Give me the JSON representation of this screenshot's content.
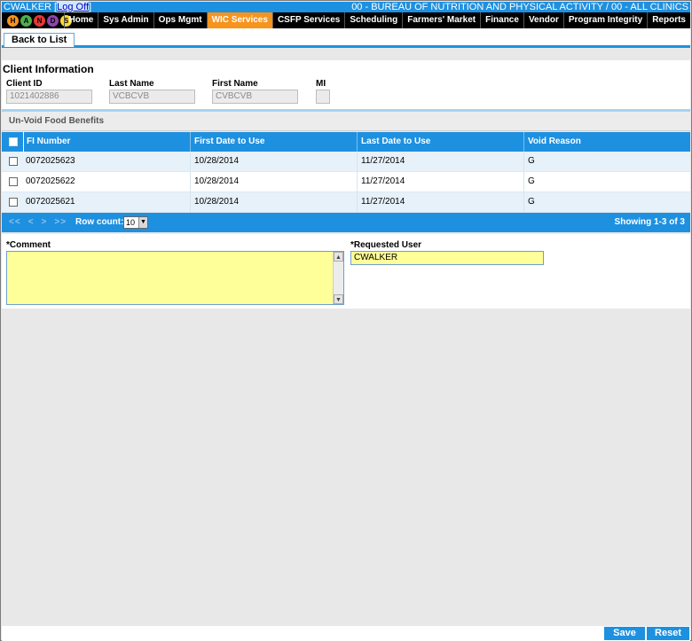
{
  "topbar": {
    "user": "CWALKER",
    "logoff": "Log Off",
    "organization": "00 - BUREAU OF NUTRITION AND PHYSICAL ACTIVITY / 00 - ALL CLINICS"
  },
  "logo": {
    "letters": [
      "H",
      "A",
      "N",
      "D",
      "S"
    ],
    "colors": [
      "#f7941d",
      "#4caf50",
      "#e53935",
      "#8e44ad",
      "#fdd835"
    ]
  },
  "nav": [
    {
      "label": "Home"
    },
    {
      "label": "Sys Admin"
    },
    {
      "label": "Ops Mgmt"
    },
    {
      "label": "WIC Services",
      "active": true
    },
    {
      "label": "CSFP Services"
    },
    {
      "label": "Scheduling"
    },
    {
      "label": "Farmers' Market"
    },
    {
      "label": "Finance"
    },
    {
      "label": "Vendor"
    },
    {
      "label": "Program Integrity"
    },
    {
      "label": "Reports"
    }
  ],
  "back_button": "Back to List",
  "client": {
    "title": "Client Information",
    "client_id_label": "Client ID",
    "client_id": "1021402886",
    "last_name_label": "Last Name",
    "last_name": "VCBCVB",
    "first_name_label": "First Name",
    "first_name": "CVBCVB",
    "mi_label": "MI",
    "mi": ""
  },
  "section_title": "Un-Void Food Benefits",
  "grid": {
    "columns": [
      "FI Number",
      "First Date to Use",
      "Last Date to Use",
      "Void Reason"
    ],
    "rows": [
      {
        "fi": "0072025623",
        "first": "10/28/2014",
        "last": "11/27/2014",
        "reason": "G"
      },
      {
        "fi": "0072025622",
        "first": "10/28/2014",
        "last": "11/27/2014",
        "reason": "G"
      },
      {
        "fi": "0072025621",
        "first": "10/28/2014",
        "last": "11/27/2014",
        "reason": "G"
      }
    ]
  },
  "pager": {
    "first": "<<",
    "prev": "<",
    "next": ">",
    "last": ">>",
    "row_count_label": "Row count:",
    "row_count": "10",
    "showing": "Showing 1-3 of 3"
  },
  "form": {
    "comment_label": "*Comment",
    "comment": "",
    "requested_user_label": "*Requested User",
    "requested_user": "CWALKER"
  },
  "footer": {
    "save": "Save",
    "reset": "Reset"
  }
}
